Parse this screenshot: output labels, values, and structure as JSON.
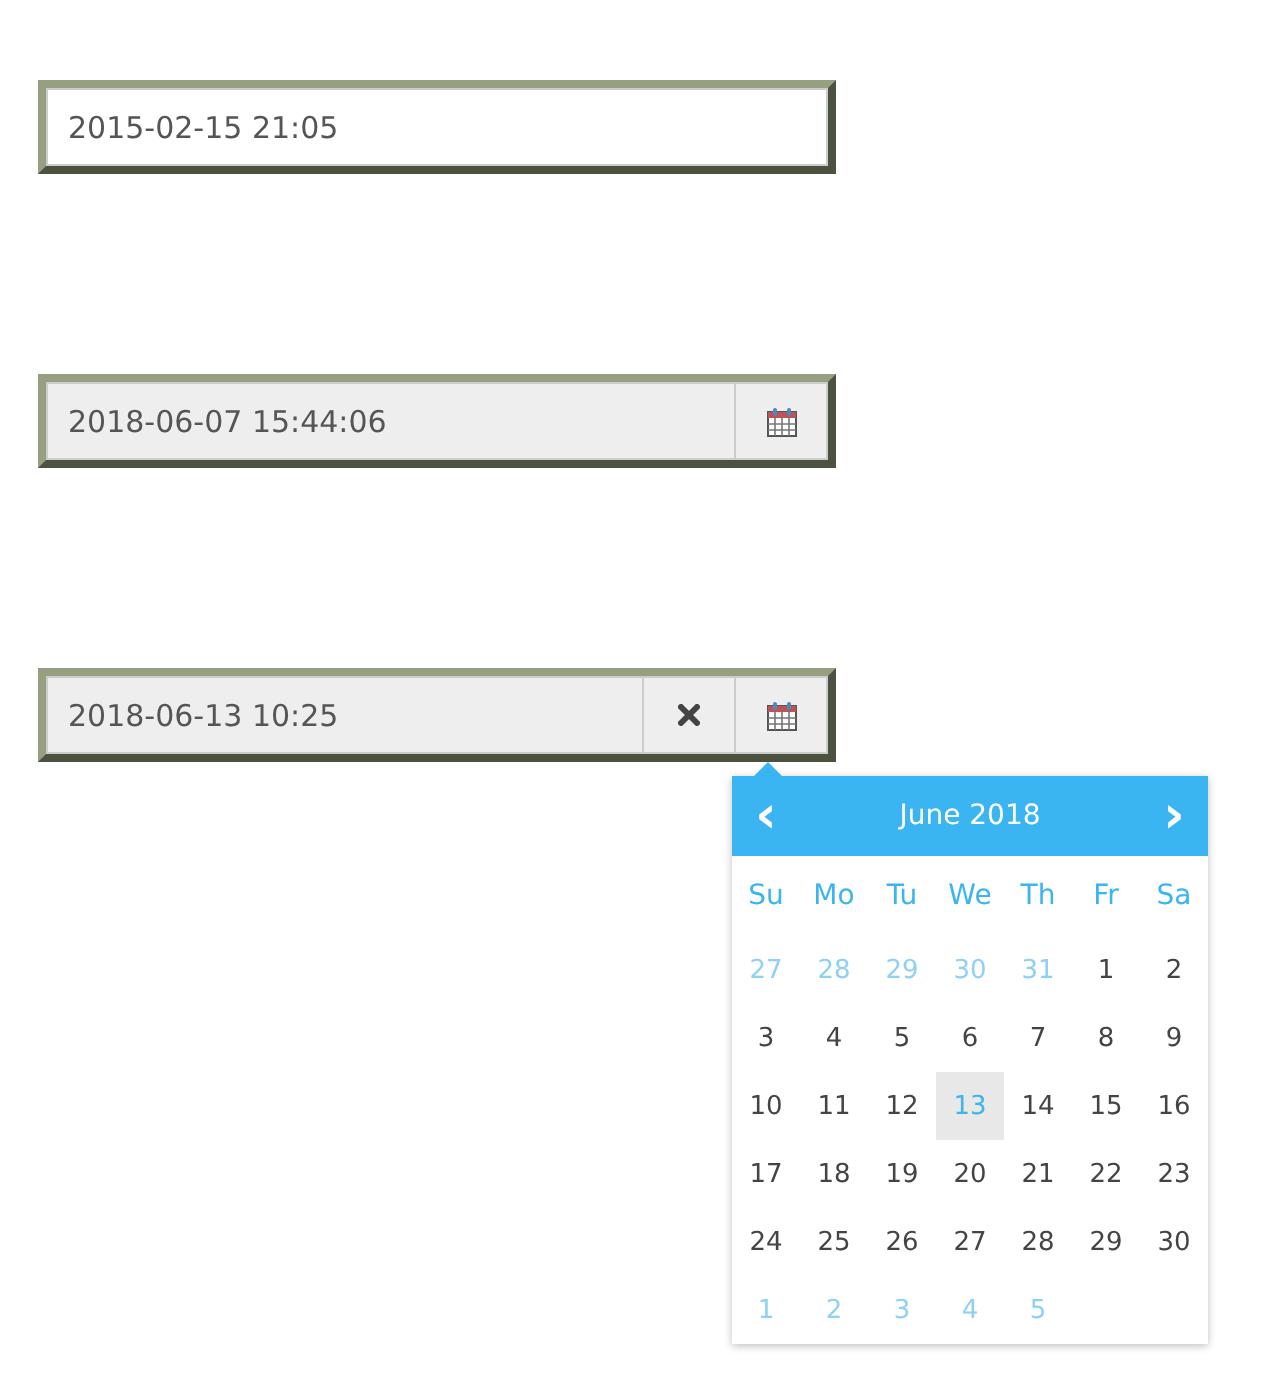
{
  "fields": [
    {
      "value": "2015-02-15 21:05"
    },
    {
      "value": "2018-06-07 15:44:06",
      "buttons": [
        {
          "kind": "calendar"
        }
      ]
    },
    {
      "value": "2018-06-13 10:25",
      "buttons": [
        {
          "kind": "clear"
        },
        {
          "kind": "calendar"
        }
      ]
    }
  ],
  "calendar": {
    "prev": "‹",
    "title": "June 2018",
    "next": "›",
    "weekdays": [
      "Su",
      "Mo",
      "Tu",
      "We",
      "Th",
      "Fr",
      "Sa"
    ],
    "weeks": [
      [
        {
          "day": "27",
          "other_month": true,
          "selected": false
        },
        {
          "day": "28",
          "other_month": true,
          "selected": false
        },
        {
          "day": "29",
          "other_month": true,
          "selected": false
        },
        {
          "day": "30",
          "other_month": true,
          "selected": false
        },
        {
          "day": "31",
          "other_month": true,
          "selected": false
        },
        {
          "day": "1",
          "other_month": false,
          "selected": false
        },
        {
          "day": "2",
          "other_month": false,
          "selected": false
        }
      ],
      [
        {
          "day": "3",
          "other_month": false,
          "selected": false
        },
        {
          "day": "4",
          "other_month": false,
          "selected": false
        },
        {
          "day": "5",
          "other_month": false,
          "selected": false
        },
        {
          "day": "6",
          "other_month": false,
          "selected": false
        },
        {
          "day": "7",
          "other_month": false,
          "selected": false
        },
        {
          "day": "8",
          "other_month": false,
          "selected": false
        },
        {
          "day": "9",
          "other_month": false,
          "selected": false
        }
      ],
      [
        {
          "day": "10",
          "other_month": false,
          "selected": false
        },
        {
          "day": "11",
          "other_month": false,
          "selected": false
        },
        {
          "day": "12",
          "other_month": false,
          "selected": false
        },
        {
          "day": "13",
          "other_month": false,
          "selected": true
        },
        {
          "day": "14",
          "other_month": false,
          "selected": false
        },
        {
          "day": "15",
          "other_month": false,
          "selected": false
        },
        {
          "day": "16",
          "other_month": false,
          "selected": false
        }
      ],
      [
        {
          "day": "17",
          "other_month": false,
          "selected": false
        },
        {
          "day": "18",
          "other_month": false,
          "selected": false
        },
        {
          "day": "19",
          "other_month": false,
          "selected": false
        },
        {
          "day": "20",
          "other_month": false,
          "selected": false
        },
        {
          "day": "21",
          "other_month": false,
          "selected": false
        },
        {
          "day": "22",
          "other_month": false,
          "selected": false
        },
        {
          "day": "23",
          "other_month": false,
          "selected": false
        }
      ],
      [
        {
          "day": "24",
          "other_month": false,
          "selected": false
        },
        {
          "day": "25",
          "other_month": false,
          "selected": false
        },
        {
          "day": "26",
          "other_month": false,
          "selected": false
        },
        {
          "day": "27",
          "other_month": false,
          "selected": false
        },
        {
          "day": "28",
          "other_month": false,
          "selected": false
        },
        {
          "day": "29",
          "other_month": false,
          "selected": false
        },
        {
          "day": "30",
          "other_month": false,
          "selected": false
        }
      ],
      [
        {
          "day": "1",
          "other_month": true,
          "selected": false
        },
        {
          "day": "2",
          "other_month": true,
          "selected": false
        },
        {
          "day": "3",
          "other_month": true,
          "selected": false
        },
        {
          "day": "4",
          "other_month": true,
          "selected": false
        },
        {
          "day": "5",
          "other_month": true,
          "selected": false
        }
      ]
    ]
  }
}
